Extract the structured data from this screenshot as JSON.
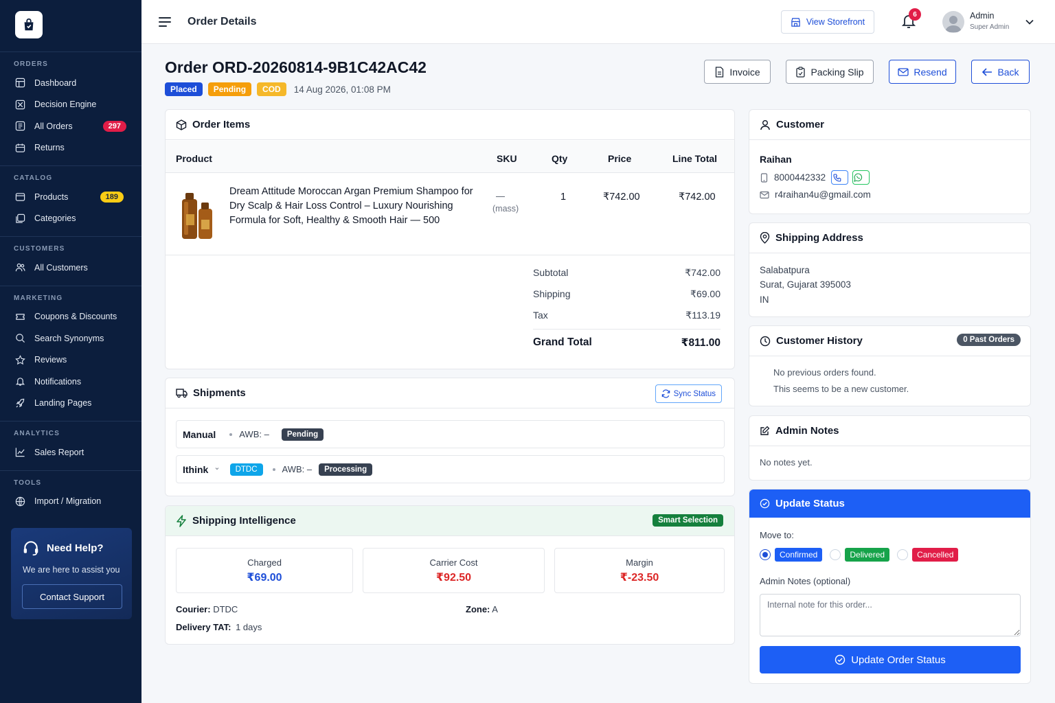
{
  "sidebar": {
    "sections": [
      {
        "title": "ORDERS",
        "items": [
          {
            "label": "Dashboard",
            "icon": "dashboard-icon"
          },
          {
            "label": "Decision Engine",
            "icon": "decision-engine-icon"
          },
          {
            "label": "All Orders",
            "icon": "orders-icon",
            "badge": "297"
          },
          {
            "label": "Returns",
            "icon": "returns-icon"
          }
        ]
      },
      {
        "title": "CATALOG",
        "items": [
          {
            "label": "Products",
            "icon": "products-icon",
            "badge": "189"
          },
          {
            "label": "Categories",
            "icon": "categories-icon"
          }
        ]
      },
      {
        "title": "CUSTOMERS",
        "items": [
          {
            "label": "All Customers",
            "icon": "customers-icon"
          }
        ]
      },
      {
        "title": "MARKETING",
        "items": [
          {
            "label": "Coupons & Discounts",
            "icon": "coupon-icon"
          },
          {
            "label": "Search Synonyms",
            "icon": "search-icon"
          },
          {
            "label": "Reviews",
            "icon": "star-icon"
          },
          {
            "label": "Notifications",
            "icon": "bell-icon"
          },
          {
            "label": "Landing Pages",
            "icon": "rocket-icon"
          }
        ]
      },
      {
        "title": "ANALYTICS",
        "items": [
          {
            "label": "Sales Report",
            "icon": "chart-icon"
          }
        ]
      },
      {
        "title": "TOOLS",
        "items": [
          {
            "label": "Import / Migration",
            "icon": "globe-icon"
          }
        ]
      }
    ],
    "help": {
      "title": "Need Help?",
      "subtitle": "We are here to assist you",
      "button": "Contact Support"
    }
  },
  "topbar": {
    "title": "Order Details",
    "view_storefront": "View Storefront",
    "notification_count": "6",
    "user_name": "Admin",
    "user_role": "Super Admin"
  },
  "order": {
    "title": "Order ORD-20260814-9B1C42AC42",
    "tags": [
      "Placed",
      "Pending",
      "COD"
    ],
    "date": "14 Aug 2026, 01:08 PM",
    "actions": {
      "invoice": "Invoice",
      "packing_slip": "Packing Slip",
      "resend": "Resend",
      "back": "Back"
    }
  },
  "items": {
    "heading": "Order Items",
    "columns": {
      "product": "Product",
      "sku": "SKU",
      "qty": "Qty",
      "price": "Price",
      "line_total": "Line Total"
    },
    "rows": [
      {
        "name": "Dream Attitude Moroccan Argan Premium Shampoo for Dry Scalp & Hair Loss Control – Luxury Nourishing Formula for Soft, Healthy & Smooth Hair —  500",
        "sku": "—",
        "sku_sub": "(mass)",
        "qty": "1",
        "price": "₹742.00",
        "line_total": "₹742.00"
      }
    ],
    "summary": {
      "subtotal_label": "Subtotal",
      "subtotal": "₹742.00",
      "shipping_label": "Shipping",
      "shipping": "₹69.00",
      "tax_label": "Tax",
      "tax": "₹113.19",
      "grand_label": "Grand Total",
      "grand": "₹811.00"
    }
  },
  "shipments": {
    "heading": "Shipments",
    "sync": "Sync Status",
    "rows": [
      {
        "carrier": "Manual",
        "awb": "AWB: –",
        "status": "Pending"
      },
      {
        "carrier": "Ithink",
        "chev": "⌄",
        "courier": "DTDC",
        "awb": "AWB: –",
        "status": "Processing"
      }
    ]
  },
  "intelligence": {
    "heading": "Shipping Intelligence",
    "badge": "Smart Selection",
    "metrics": [
      {
        "label": "Charged",
        "value": "₹69.00",
        "color": "#1d4ed8"
      },
      {
        "label": "Carrier Cost",
        "value": "₹92.50",
        "color": "#dc2626"
      },
      {
        "label": "Margin",
        "value": "₹-23.50",
        "color": "#dc2626"
      }
    ],
    "courier_label": "Courier:",
    "courier": "DTDC",
    "zone_label": "Zone:",
    "zone": "A",
    "tat_label": "Delivery TAT:",
    "tat": "1 days"
  },
  "customer": {
    "heading": "Customer",
    "name": "Raihan",
    "phone": "8000442332",
    "email": "r4raihan4u@gmail.com"
  },
  "address": {
    "heading": "Shipping Address",
    "line1": "Salabatpura",
    "line2": "Surat, Gujarat 395003",
    "line3": "IN"
  },
  "history": {
    "heading": "Customer History",
    "badge": "0 Past Orders",
    "line1": "No previous orders found.",
    "line2": "This seems to be a new customer."
  },
  "notes": {
    "heading": "Admin Notes",
    "text": "No notes yet."
  },
  "status": {
    "heading": "Update Status",
    "move_to": "Move to:",
    "options": [
      {
        "label": "Confirmed",
        "selected": true
      },
      {
        "label": "Delivered",
        "selected": false
      },
      {
        "label": "Cancelled",
        "selected": false
      }
    ],
    "notes_label": "Admin Notes (optional)",
    "notes_placeholder": "Internal note for this order...",
    "button": "Update Order Status"
  },
  "colors": {
    "sidebar": "#0c1e3d",
    "primary": "#1d5ff5",
    "danger": "#e11d48",
    "success": "#16a34a"
  }
}
